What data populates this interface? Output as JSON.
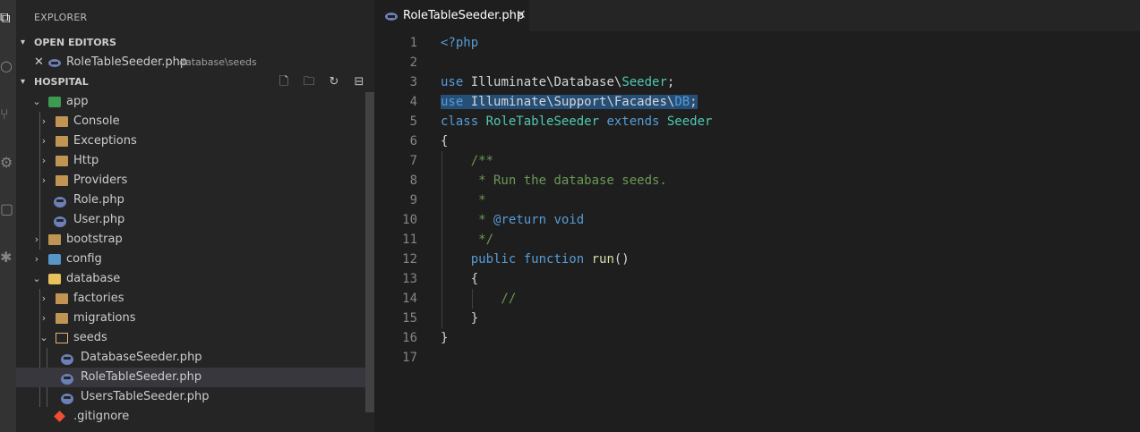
{
  "activity_bar": {
    "icons": [
      "files-icon",
      "search-icon",
      "source-control-icon",
      "debug-icon",
      "extensions-icon",
      "remote-icon"
    ]
  },
  "explorer": {
    "title": "EXPLORER",
    "open_editors": {
      "label": "OPEN EDITORS",
      "items": [
        {
          "name": "RoleTableSeeder.php",
          "path": "database\\seeds"
        }
      ]
    },
    "project": {
      "label": "HOSPITAL",
      "actions": [
        "new-file-icon",
        "new-folder-icon",
        "refresh-icon",
        "collapse-all-icon"
      ],
      "tree": [
        {
          "name": "app",
          "expanded": true,
          "icon": "app-folder-icon"
        },
        {
          "name": "Console",
          "icon": "console-folder-icon"
        },
        {
          "name": "Exceptions",
          "icon": "folder-icon"
        },
        {
          "name": "Http",
          "icon": "folder-icon"
        },
        {
          "name": "Providers",
          "icon": "folder-icon"
        },
        {
          "name": "Role.php",
          "icon": "php-icon"
        },
        {
          "name": "User.php",
          "icon": "php-icon"
        },
        {
          "name": "bootstrap",
          "icon": "folder-icon"
        },
        {
          "name": "config",
          "icon": "config-folder-icon"
        },
        {
          "name": "database",
          "expanded": true,
          "icon": "database-folder-icon"
        },
        {
          "name": "factories",
          "icon": "folder-icon"
        },
        {
          "name": "migrations",
          "icon": "folder-icon"
        },
        {
          "name": "seeds",
          "expanded": true,
          "icon": "folder-open-icon"
        },
        {
          "name": "DatabaseSeeder.php",
          "icon": "php-icon"
        },
        {
          "name": "RoleTableSeeder.php",
          "icon": "php-icon",
          "selected": true
        },
        {
          "name": "UsersTableSeeder.php",
          "icon": "php-icon"
        },
        {
          "name": ".gitignore",
          "icon": "git-icon"
        }
      ]
    }
  },
  "editor": {
    "tab": {
      "label": "RoleTableSeeder.php",
      "close": "✕"
    },
    "lines": [
      {
        "num": "1"
      },
      {
        "num": "2"
      },
      {
        "num": "3"
      },
      {
        "num": "4"
      },
      {
        "num": "5"
      },
      {
        "num": "6"
      },
      {
        "num": "7"
      },
      {
        "num": "8"
      },
      {
        "num": "9"
      },
      {
        "num": "10"
      },
      {
        "num": "11"
      },
      {
        "num": "12"
      },
      {
        "num": "13"
      },
      {
        "num": "14"
      },
      {
        "num": "15"
      },
      {
        "num": "16"
      },
      {
        "num": "17"
      }
    ],
    "code": {
      "l1": "<?php",
      "l3_use": "use",
      "l3_ns": " Illuminate\\Database\\",
      "l3_cls": "Seeder",
      "l3_end": ";",
      "l4_use": "use",
      "l4_ns": " Illuminate\\Support\\Facades\\",
      "l4_cls": "DB",
      "l4_end": ";",
      "l5_class": "class",
      "l5_name": " RoleTableSeeder",
      "l5_extends": " extends",
      "l5_parent": " Seeder",
      "l6": "{",
      "l7": "    /**",
      "l8": "     * Run the database seeds.",
      "l9": "     *",
      "l10_star": "     * ",
      "l10_tag": "@return",
      "l10_type": " void",
      "l11": "     */",
      "l12_public": "    public",
      "l12_function": " function",
      "l12_name": " run",
      "l12_parens": "()",
      "l13": "    {",
      "l14": "        //",
      "l15": "    }",
      "l16": "}"
    }
  },
  "colors": {
    "keyword": "#569cd6",
    "type": "#4ec9b0",
    "function": "#dcdcaa",
    "comment": "#6a9955",
    "selection": "#264f78"
  }
}
